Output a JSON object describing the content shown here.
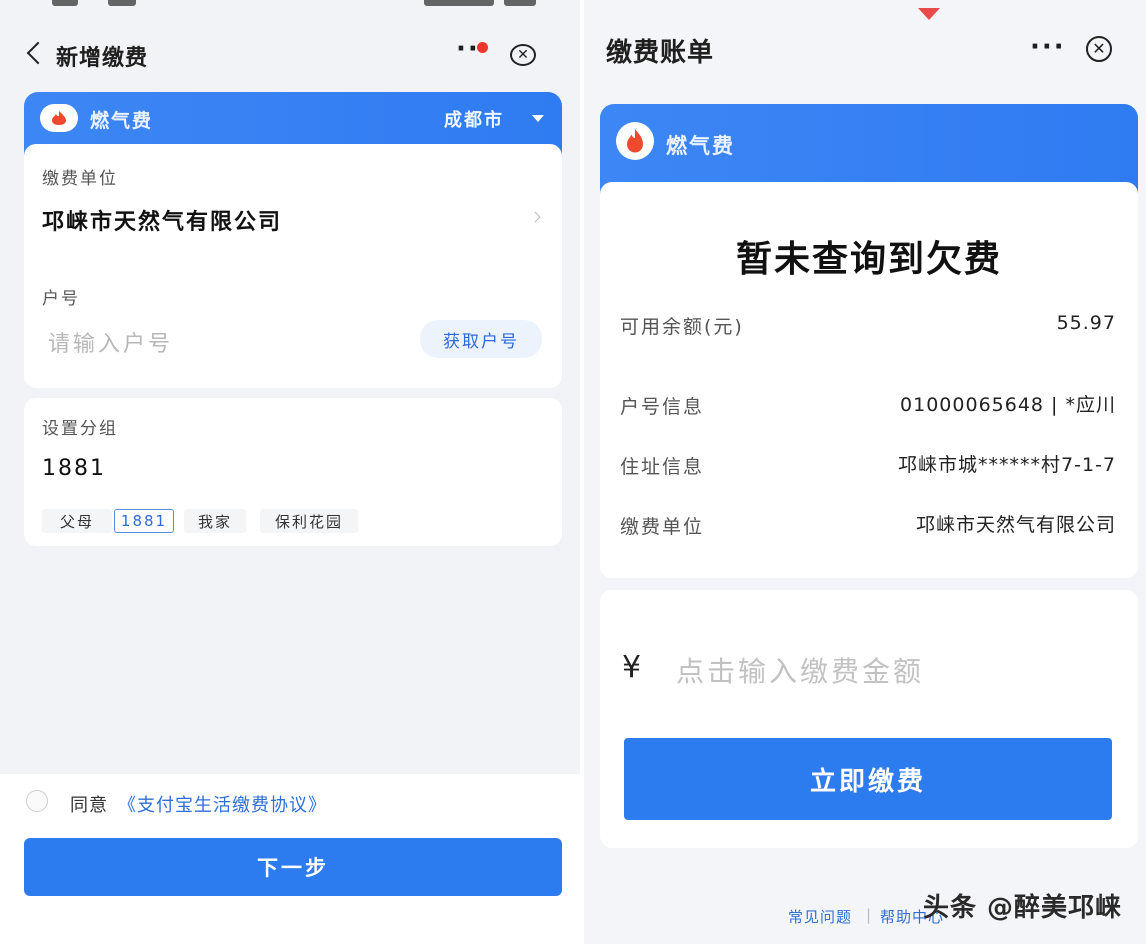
{
  "left": {
    "title": "新增缴费",
    "service": {
      "name": "燃气费",
      "city": "成都市"
    },
    "unit": {
      "label": "缴费单位",
      "value": "邛崃市天然气有限公司"
    },
    "account": {
      "label": "户号",
      "placeholder": "请输入户号",
      "get_button": "获取户号"
    },
    "group": {
      "label": "设置分组",
      "value": "1881",
      "chips": [
        {
          "label": "父母",
          "selected": false
        },
        {
          "label": "1881",
          "selected": true
        },
        {
          "label": "我家",
          "selected": false
        },
        {
          "label": "保利花园",
          "selected": false
        }
      ]
    },
    "agree": {
      "prefix": "同意",
      "link": "《支付宝生活缴费协议》"
    },
    "next_button": "下一步"
  },
  "right": {
    "title": "缴费账单",
    "service": {
      "name": "燃气费"
    },
    "heading": "暂未查询到欠费",
    "rows": [
      {
        "label": "可用余额(元)",
        "value": "55.97"
      },
      {
        "label": "户号信息",
        "value": "01000065648 | *应川"
      },
      {
        "label": "住址信息",
        "value": "邛崃市城******村7-1-7"
      },
      {
        "label": "缴费单位",
        "value": "邛崃市天然气有限公司"
      }
    ],
    "amount": {
      "currency": "¥",
      "placeholder": "点击输入缴费金额"
    },
    "pay_button": "立即缴费",
    "footer": {
      "left": "常见问题",
      "right": "帮助中心"
    }
  },
  "watermark": "头条 @醉美邛崃",
  "colors": {
    "accent": "#2c7bef",
    "flame": "#f04a2e",
    "link": "#2f6fd6"
  },
  "icons": [
    "back-icon",
    "more-icon",
    "close-icon",
    "flame-icon",
    "caret-down-icon",
    "chevron-right-icon"
  ]
}
